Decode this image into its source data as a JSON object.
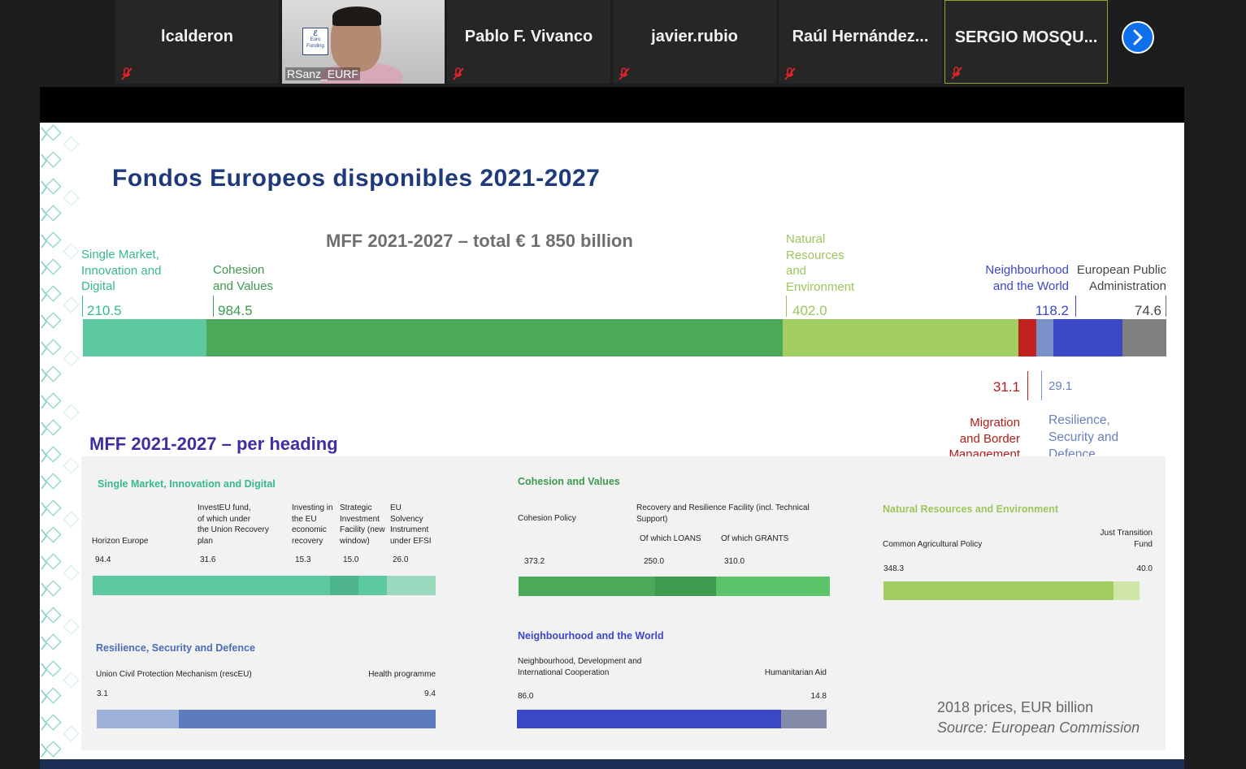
{
  "participants": [
    {
      "name": "lcalderon"
    },
    {
      "name": "Pablo F. Vivanco"
    },
    {
      "name": "javier.rubio"
    },
    {
      "name": "Raúl Hernández..."
    },
    {
      "name": "SERGIO MOSQU..."
    }
  ],
  "video_participant": {
    "name": "RSanz_EURF",
    "logo_text": "Euro Funding"
  },
  "slide": {
    "title": "Fondos Europeos disponibles 2021-2027",
    "total_heading": "MFF 2021-2027 – total € 1 850 billion",
    "per_heading_title": "MFF 2021-2027 – per heading",
    "note_prices": "2018 prices, EUR billion",
    "note_source": "Source: European Commission",
    "colors": {
      "single_market": "#5cc9a0",
      "cohesion": "#4aaa5a",
      "natural": "#a3cf62",
      "migration": "#c0201e",
      "resilience": "#7a90c8",
      "neighbourhood": "#3a48c8",
      "admin": "#808080"
    }
  },
  "chart_data": [
    {
      "type": "bar",
      "title": "MFF 2021-2027 – total € 1 850 billion",
      "orientation": "horizontal-stacked",
      "categories": [
        "Single Market, Innovation and Digital",
        "Cohesion and Values",
        "Natural Resources and Environment",
        "Migration and Border Management",
        "Resilience, Security and Defence",
        "Neighbourhood and the World",
        "European Public Administration"
      ],
      "values": [
        210.5,
        984.5,
        402.0,
        31.1,
        29.1,
        118.2,
        74.6
      ],
      "labels": [
        "210.5",
        "984.5",
        "402.0",
        "31.1",
        "29.1",
        "118.2",
        "74.6"
      ]
    },
    {
      "type": "bar",
      "title": "Single Market, Innovation and Digital",
      "orientation": "horizontal-stacked",
      "categories": [
        "Horizon Europe",
        "InvestEU fund, of which under the Union Recovery plan",
        "Investing in the EU economic recovery",
        "Strategic Investment Facility (new window)",
        "EU Solvency Instrument under EFSI"
      ],
      "values": [
        94.4,
        31.6,
        15.3,
        15.0,
        26.0
      ]
    },
    {
      "type": "bar",
      "title": "Cohesion and Values",
      "orientation": "horizontal-stacked",
      "categories": [
        "Cohesion Policy",
        "Recovery and Resilience Facility (incl. Technical Support)",
        "Of which LOANS",
        "Of which GRANTS"
      ],
      "values": [
        373.2,
        null,
        250.0,
        310.0
      ]
    },
    {
      "type": "bar",
      "title": "Natural Resources and Environment",
      "orientation": "horizontal-stacked",
      "categories": [
        "Common Agricultural Policy",
        "Just Transition Fund"
      ],
      "values": [
        348.3,
        40.0
      ]
    },
    {
      "type": "bar",
      "title": "Resilience, Security and Defence",
      "orientation": "horizontal-stacked",
      "categories": [
        "Union Civil Protection Mechanism (rescEU)",
        "Health programme"
      ],
      "values": [
        3.1,
        9.4
      ]
    },
    {
      "type": "bar",
      "title": "Neighbourhood and the World",
      "orientation": "horizontal-stacked",
      "categories": [
        "Neighbourhood, Development and International Cooperation",
        "Humanitarian Aid"
      ],
      "values": [
        86.0,
        14.8
      ]
    }
  ],
  "top_labels": {
    "single_market": {
      "l1": "Single Market,",
      "l2": "Innovation and",
      "l3": "Digital",
      "value": "210.5"
    },
    "cohesion": {
      "l1": "Cohesion",
      "l2": "and Values",
      "value": "984.5"
    },
    "natural": {
      "l1": "Natural",
      "l2": "Resources",
      "l3": "and",
      "l4": "Environment",
      "value": "402.0"
    },
    "neighbourhood": {
      "l1": "Neighbourhood",
      "l2": "and the World",
      "value": "118.2"
    },
    "admin": {
      "l1": "European Public",
      "l2": "Administration",
      "value": "74.6"
    },
    "migration": {
      "l1": "Migration",
      "l2": "and Border",
      "l3": "Management",
      "value": "31.1"
    },
    "resilience": {
      "l1": "Resilience,",
      "l2": "Security and",
      "l3": "Defence",
      "value": "29.1"
    }
  },
  "panels": {
    "single_market": {
      "title": "Single Market, Innovation and Digital",
      "items": [
        {
          "l1": "Horizon Europe",
          "value": "94.4"
        },
        {
          "l1": "InvestEU fund,",
          "l2": "of which under",
          "l3": "the Union Recovery",
          "l4": "plan",
          "value": "31.6"
        },
        {
          "l1": "Investing in",
          "l2": "the EU",
          "l3": "economic",
          "l4": "recovery",
          "value": "15.3"
        },
        {
          "l1": "Strategic",
          "l2": "Investment",
          "l3": "Facility (new",
          "l4": "window)",
          "value": "15.0"
        },
        {
          "l1": "EU",
          "l2": "Solvency",
          "l3": "Instrument",
          "l4": "under EFSI",
          "value": "26.0"
        }
      ]
    },
    "cohesion": {
      "title": "Cohesion and Values",
      "items": [
        {
          "l1": "Cohesion Policy",
          "value": "373.2"
        },
        {
          "l1": "Recovery and Resilience Facility (incl. Technical",
          "l2": "Support)"
        },
        {
          "l1": "Of which LOANS",
          "value": "250.0"
        },
        {
          "l1": "Of which GRANTS",
          "value": "310.0"
        }
      ]
    },
    "natural": {
      "title": "Natural Resources and Environment",
      "items": [
        {
          "l1": "Common Agricultural Policy",
          "value": "348.3"
        },
        {
          "l1": "Just Transition",
          "l2": "Fund",
          "value": "40.0"
        }
      ]
    },
    "resilience": {
      "title": "Resilience, Security and Defence",
      "items": [
        {
          "l1": "Union Civil Protection Mechanism (rescEU)",
          "value": "3.1"
        },
        {
          "l1": "Health programme",
          "value": "9.4"
        }
      ]
    },
    "neighbourhood": {
      "title": "Neighbourhood and the World",
      "items": [
        {
          "l1": "Neighbourhood, Development and",
          "l2": "International Cooperation",
          "value": "86.0"
        },
        {
          "l1": "Humanitarian Aid",
          "value": "14.8"
        }
      ]
    }
  }
}
